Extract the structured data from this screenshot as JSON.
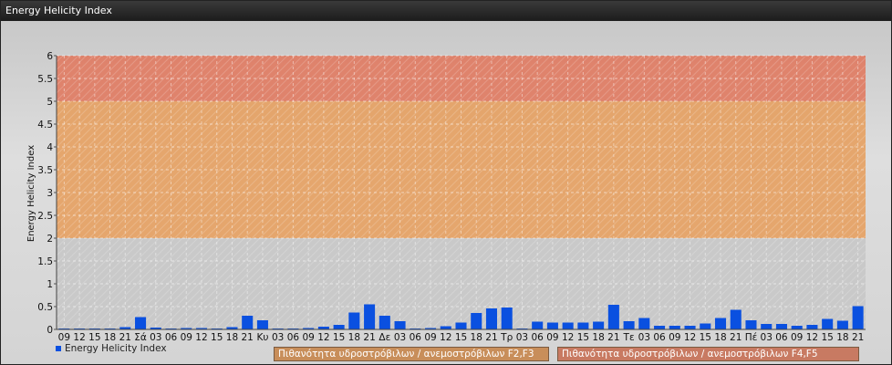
{
  "window": {
    "title": "Energy Helicity Index"
  },
  "legend": {
    "series_label": "Energy Helicity Index"
  },
  "bands": [
    {
      "label": "Πιθανότητα υδροστρόβιλων / ανεμοστρόβιλων F2,F3",
      "from": 2,
      "to": 5,
      "color": "#e6a060"
    },
    {
      "label": "Πιθανότητα υδροστρόβιλων / ανεμοστρόβιλων F4,F5",
      "from": 5,
      "to": 6,
      "color": "#e07a60"
    }
  ],
  "colors": {
    "bar": "#0a50e0",
    "band_low": "#c9c9c9"
  },
  "chart_data": {
    "type": "bar",
    "ylabel": "Energy Helicity Index",
    "ylim": [
      0,
      6
    ],
    "yticks": [
      "0",
      "0.5",
      "1",
      "1.5",
      "2",
      "2.5",
      "3",
      "3.5",
      "4",
      "4.5",
      "5",
      "5.5",
      "6"
    ],
    "categories": [
      "09",
      "12",
      "15",
      "18",
      "21",
      "Σά",
      "03",
      "06",
      "09",
      "12",
      "15",
      "18",
      "21",
      "Κυ",
      "03",
      "06",
      "09",
      "12",
      "15",
      "18",
      "21",
      "Δε",
      "03",
      "06",
      "09",
      "12",
      "15",
      "18",
      "21",
      "Τρ",
      "03",
      "06",
      "09",
      "12",
      "15",
      "18",
      "21",
      "Τε",
      "03",
      "06",
      "09",
      "12",
      "15",
      "18",
      "21",
      "Πέ",
      "03",
      "06",
      "09",
      "12",
      "15",
      "18",
      "21"
    ],
    "values": [
      0.02,
      0.02,
      0.02,
      0.02,
      0.05,
      0.27,
      0.04,
      0.02,
      0.03,
      0.03,
      0.02,
      0.05,
      0.3,
      0.2,
      0.02,
      0.02,
      0.03,
      0.06,
      0.1,
      0.37,
      0.55,
      0.3,
      0.18,
      0.02,
      0.03,
      0.07,
      0.15,
      0.36,
      0.46,
      0.48,
      0.02,
      0.17,
      0.15,
      0.15,
      0.15,
      0.17,
      0.54,
      0.18,
      0.25,
      0.08,
      0.08,
      0.08,
      0.13,
      0.25,
      0.43,
      0.2,
      0.12,
      0.12,
      0.08,
      0.1,
      0.23,
      0.19,
      0.51
    ],
    "grid": true
  }
}
